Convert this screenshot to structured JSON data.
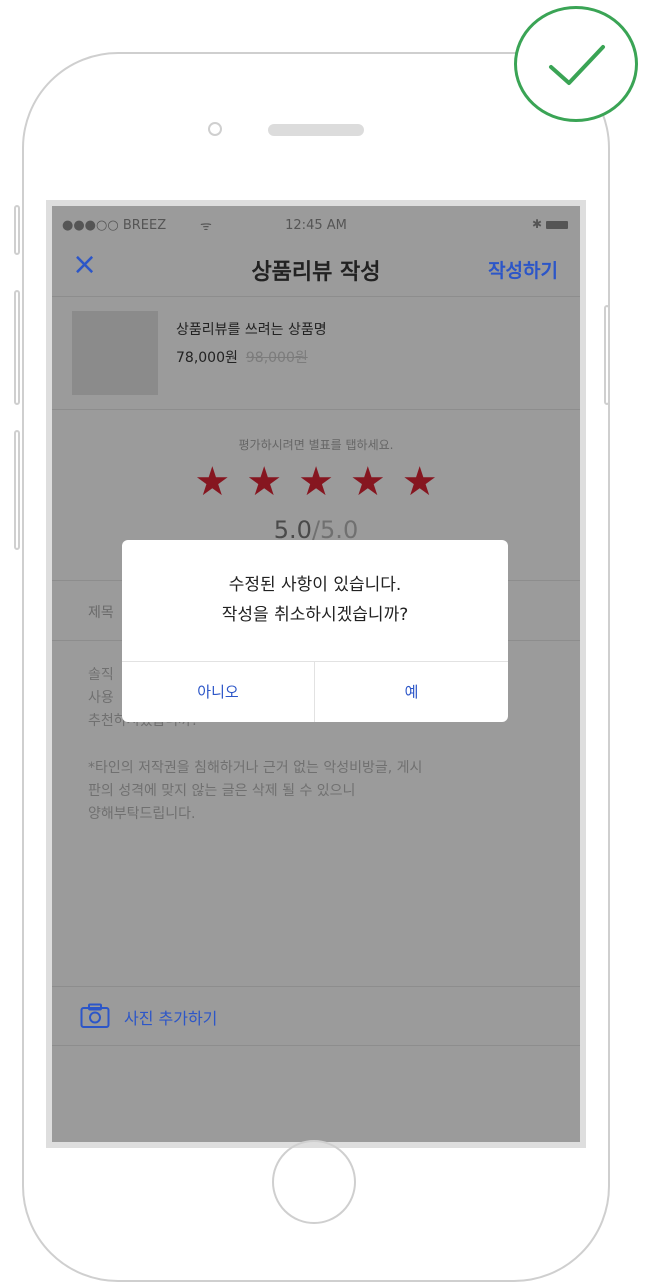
{
  "status_bar": {
    "carrier": "●●●○○ BREEZ",
    "wifi": "ᯤ",
    "time": "12:45 AM",
    "bluetooth": "✱"
  },
  "nav": {
    "close": "×",
    "title": "상품리뷰 작성",
    "submit": "작성하기"
  },
  "product": {
    "name": "상품리뷰를 쓰려는 상품명",
    "price": "78,000원",
    "original_price": "98,000원"
  },
  "rating": {
    "hint": "평가하시려면 별표를 탭하세요.",
    "stars": [
      "★",
      "★",
      "★",
      "★",
      "★"
    ],
    "score": "5.0",
    "max": "/5.0"
  },
  "title_field": {
    "placeholder_visible": "제목"
  },
  "body_placeholder": {
    "line1": "솔직",
    "line2": "사용",
    "line3": "추천하시겠습니까?",
    "notice1": "*타인의 저작권을 침해하거나 근거 없는 악성비방글, 게시",
    "notice2": "판의 성격에 맞지 않는 글은 삭제 될 수 있으니",
    "notice3": "양해부탁드립니다."
  },
  "photo": {
    "label": "사진 추가하기",
    "icon": "camera-icon"
  },
  "dialog": {
    "line1": "수정된 사항이 있습니다.",
    "line2": "작성을 취소하시겠습니까?",
    "no": "아니오",
    "yes": "예"
  },
  "colors": {
    "accent": "#2c56c8",
    "star": "#861620",
    "check": "#3aa455",
    "overlay": "#9b9b9b"
  }
}
